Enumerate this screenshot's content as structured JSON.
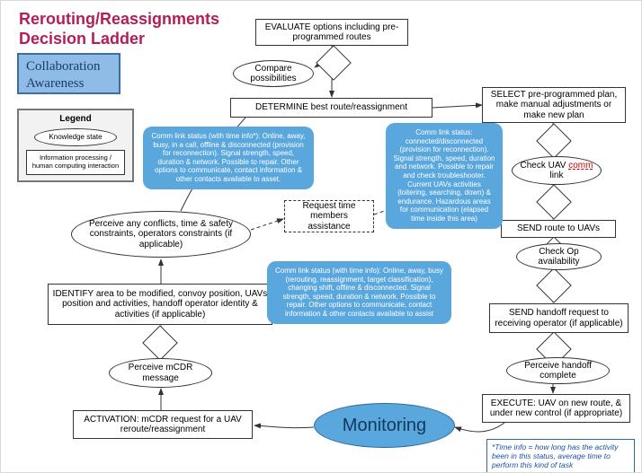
{
  "title_line1": "Rerouting/Reassignments",
  "title_line2": "Decision Ladder",
  "collab_l1": "Collaboration",
  "collab_l2": "Awareness",
  "legend": {
    "title": "Legend",
    "knowledge": "Knowledge state",
    "processing": "Information processing / human computing interaction"
  },
  "nodes": {
    "evaluate": "EVALUATE options including pre-programmed routes",
    "compare": "Compare possibilities",
    "determine": "DETERMINE best route/reassignment",
    "select": "SELECT pre-programmed plan, make manual adjustments or make new plan",
    "check_comm": "Check UAV comm link",
    "send_route": "SEND route to UAVs",
    "check_op": "Check Op availability",
    "send_handoff": "SEND handoff request to receiving operator (if applicable)",
    "perceive_handoff": "Perceive handoff complete",
    "execute": "EXECUTE: UAV on new route, & under new control (if appropriate)",
    "request_members": "Request time members assistance",
    "perceive_conflicts": "Perceive any conflicts, time & safety constraints, operators constraints (if applicable)",
    "identify": "IDENTIFY area to be modified, convoy position, UAVs position and activities, handoff operator identity & activities (if applicable)",
    "perceive_mcdr": "Perceive mCDR message",
    "activation": "ACTIVATION: mCDR request for a UAV reroute/reassignment"
  },
  "bubbles": {
    "b1": "Comm link status (with time info*): Online, away, busy, in a call, offline & disconnected (provision for reconnection). Signal strength, speed, duration & network. Possible to repair. Other options to communicate, contact information & other contacts available to asset.",
    "b2": "Comm link status: connected/disconnected (provision for reconnection). Signal strength, speed, duration and network. Possible to repair and check troubleshooter. Current UAVs activities (loitering, searching, down) & endurance. Hazardous areas for communication (elapsed time inside this area)",
    "b3": "Comm link status (with time info): Online, away, busy (rerouting, reassignment, target classification), changing shift, offline & disconnected. Signal strength, speed, duration & network. Possible to repair. Other options to communicate, contact information & other contacts available to assist"
  },
  "monitoring": "Monitoring",
  "footnote": "*Time info = how long has the activity been in this status, average time to perform this kind of task",
  "comm_word": "comm"
}
